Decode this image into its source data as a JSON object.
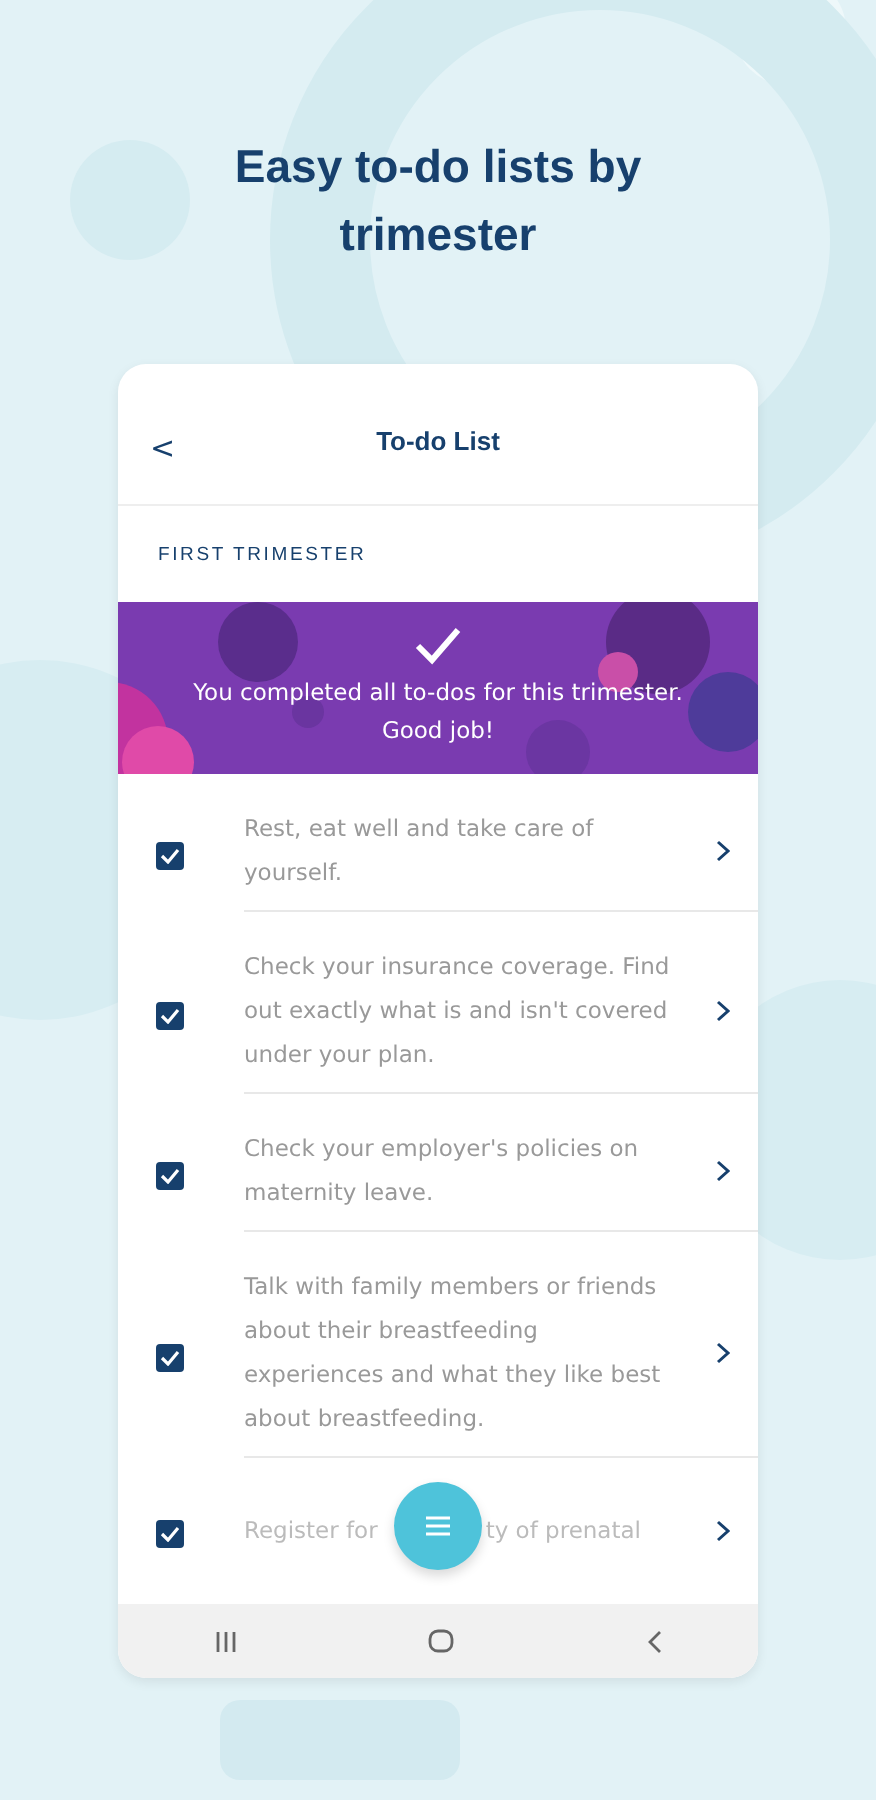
{
  "headline": "Easy to-do lists by trimester",
  "screen": {
    "title": "To-do List",
    "back": "<",
    "section": "FIRST TRIMESTER"
  },
  "banner": {
    "message": "You completed all to-dos for this trimester. Good job!"
  },
  "todos": [
    {
      "parts": [
        "Rest, eat well and take care of yourself."
      ],
      "checked": true
    },
    {
      "parts": [
        "Check your insurance coverage. Find out exactly what is and isn't covered under your plan."
      ],
      "checked": true
    },
    {
      "parts": [
        "Check your employer's policies on maternity leave."
      ],
      "checked": true
    },
    {
      "parts": [
        "Talk with family members or friends about their breastfeeding experiences and what they like best about breastfeeding."
      ],
      "checked": true
    },
    {
      "parts": [
        "Register for",
        "ty of prenatal"
      ],
      "checked": true
    }
  ]
}
